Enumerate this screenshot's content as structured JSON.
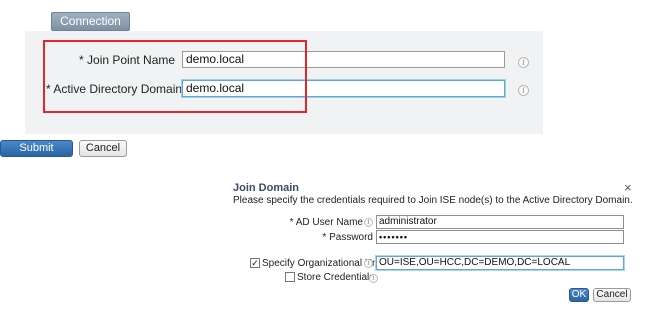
{
  "connection": {
    "tab_label": "Connection",
    "join_point_name": {
      "star": "*",
      "label": "Join Point Name",
      "value": "demo.local"
    },
    "active_directory_domain": {
      "star": "*",
      "label": "Active Directory Domain",
      "value": "demo.local"
    },
    "info_glyph": "i"
  },
  "actions": {
    "submit_label": "Submit",
    "cancel_label": "Cancel"
  },
  "join_domain": {
    "title": "Join Domain",
    "description": "Please specify the credentials required to Join ISE node(s) to the Active Directory Domain.",
    "close_glyph": "×",
    "ad_user_name": {
      "label": "* AD User Name",
      "value": "administrator"
    },
    "password": {
      "label": "* Password",
      "value": "•••••••"
    },
    "specify_ou": {
      "checked": true,
      "check_glyph": "✓",
      "label": "Specify Organizational Unit",
      "value": "OU=ISE,OU=HCC,DC=DEMO,DC=LOCAL"
    },
    "store_credentials": {
      "checked": false,
      "label": "Store Credentials"
    },
    "ok_label": "OK",
    "cancel_label": "Cancel"
  }
}
